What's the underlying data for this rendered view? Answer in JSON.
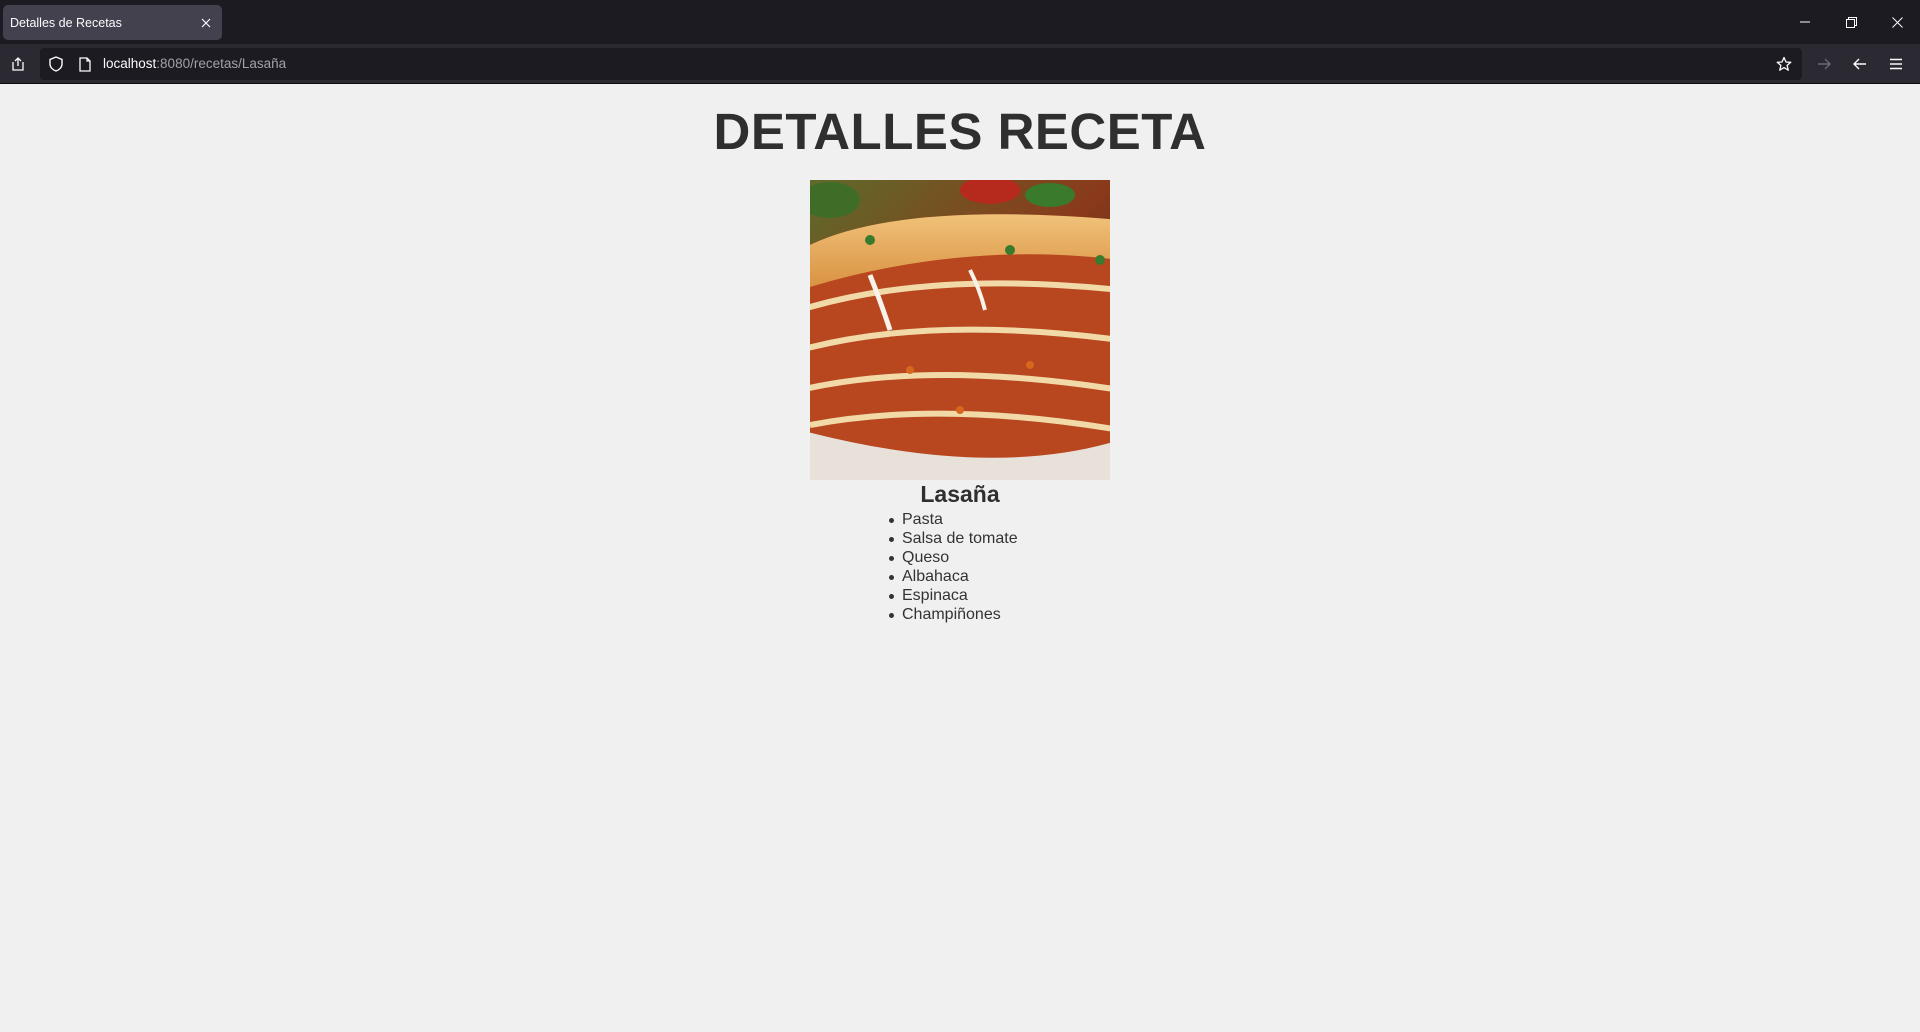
{
  "browser": {
    "tab_title": "Detalles de Recetas",
    "url_host": "localhost",
    "url_rest": ":8080/recetas/Lasaña"
  },
  "page": {
    "title": "DETALLES RECETA",
    "recipe_name": "Lasaña",
    "image_subject": "lasagna-photo",
    "ingredients": [
      "Pasta",
      "Salsa de tomate",
      "Queso",
      "Albahaca",
      "Espinaca",
      "Champiñones"
    ]
  },
  "colors": {
    "page_background": "#f0f0f0",
    "browser_chrome": "#1c1b22",
    "heading_text": "#2f2f2f"
  }
}
